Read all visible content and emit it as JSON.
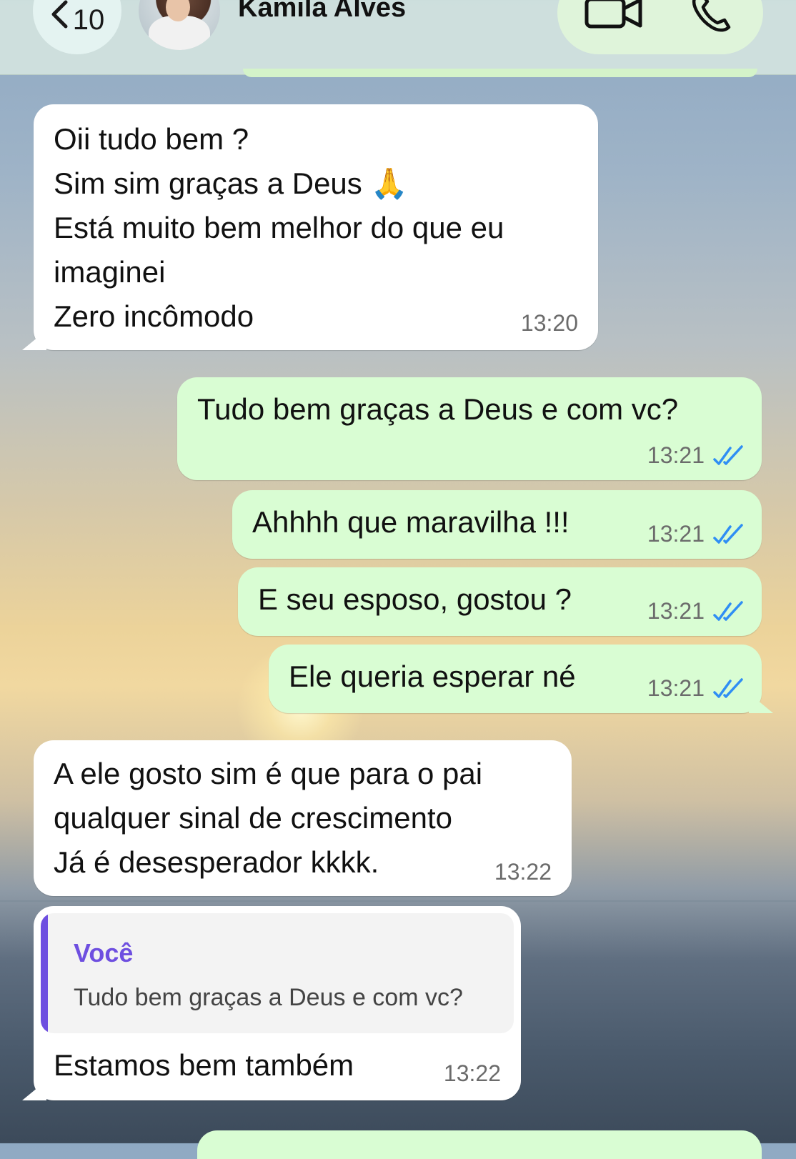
{
  "header": {
    "back_count": "10",
    "contact_name": "Kamila Alves"
  },
  "messages": [
    {
      "dir": "in",
      "lines": [
        "Oii tudo bem ?",
        "Sim sim graças a Deus 🙏",
        "Está muito bem melhor do que eu",
        "imaginei",
        "Zero incômodo"
      ],
      "time": "13:20"
    },
    {
      "dir": "out",
      "text": "Tudo bem graças a Deus e com vc?",
      "time": "13:21",
      "status": "read"
    },
    {
      "dir": "out",
      "text": "Ahhhh que maravilha !!!",
      "time": "13:21",
      "status": "read"
    },
    {
      "dir": "out",
      "text": "E seu esposo, gostou ?",
      "time": "13:21",
      "status": "read"
    },
    {
      "dir": "out",
      "text": "Ele queria esperar né",
      "time": "13:21",
      "status": "read"
    },
    {
      "dir": "in",
      "lines": [
        "A ele gosto sim é que para o pai",
        "qualquer sinal de crescimento",
        "Já é desesperador kkkk."
      ],
      "time": "13:22"
    },
    {
      "dir": "in",
      "quote_author": "Você",
      "quote_text": "Tudo bem graças a Deus e com vc?",
      "text": "Estamos bem também",
      "time": "13:22"
    }
  ],
  "colors": {
    "incoming": "#ffffff",
    "outgoing": "#d9fdd3",
    "read_ticks": "#2f8ef4",
    "quote_accent": "#6e4fe0"
  }
}
